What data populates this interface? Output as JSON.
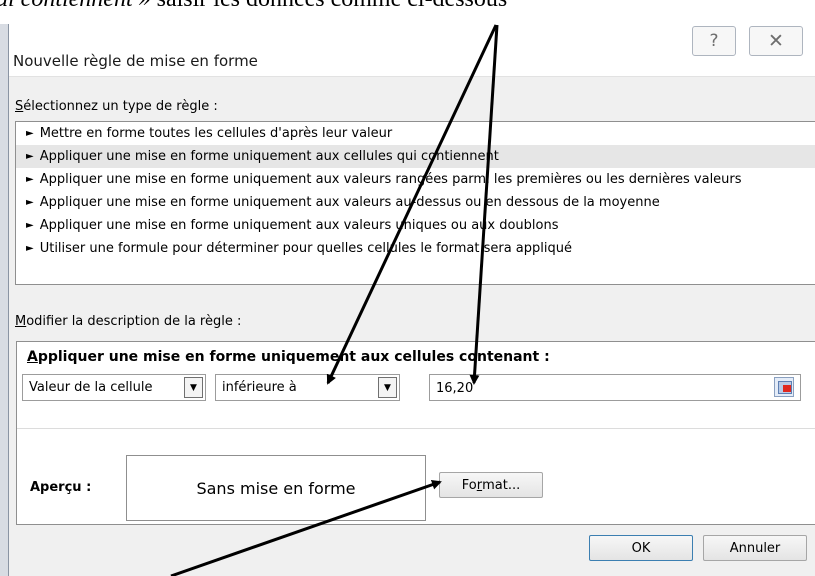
{
  "caption": {
    "italic_part": "ui contiennent »",
    "normal_part": " saisir les données comme ci-dessous"
  },
  "dialog": {
    "title": "Nouvelle règle de mise en forme",
    "help_glyph": "?",
    "close_glyph": "✕",
    "rule_type_label_key": "S",
    "rule_type_label_rest": "électionnez un type de règle :",
    "rule_types": [
      {
        "label": "Mettre en forme toutes les cellules d'après leur valeur",
        "selected": false
      },
      {
        "label": "Appliquer une mise en forme uniquement aux cellules qui contiennent",
        "selected": true
      },
      {
        "label": "Appliquer une mise en forme uniquement aux valeurs rangées parmi les premières ou les dernières valeurs",
        "selected": false
      },
      {
        "label": "Appliquer une mise en forme uniquement aux valeurs au-dessus ou en dessous de la moyenne",
        "selected": false
      },
      {
        "label": "Appliquer une mise en forme uniquement aux valeurs uniques ou aux doublons",
        "selected": false
      },
      {
        "label": "Utiliser une formule pour déterminer pour quelles cellules le format sera appliqué",
        "selected": false
      }
    ],
    "bullet": "►",
    "edit_label_key": "M",
    "edit_label_rest": "odifier la description de la règle :",
    "desc_title_key": "A",
    "desc_title_rest": "ppliquer une mise en forme uniquement aux cellules contenant :",
    "condition_field": "Valeur de la cellule",
    "operator": "inférieure à",
    "value": "16,20",
    "dropdown_glyph": "▼",
    "preview_label": "Aperçu :",
    "preview_text": "Sans mise en forme",
    "format_button_pre": "Fo",
    "format_button_key": "r",
    "format_button_post": "mat...",
    "ok_label": "OK",
    "cancel_label": "Annuler"
  }
}
